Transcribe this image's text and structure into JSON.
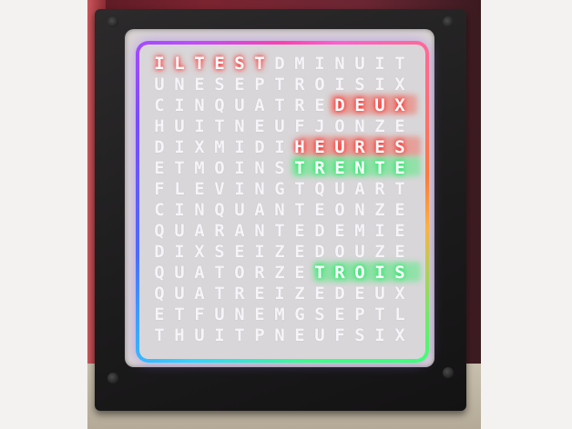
{
  "clock": {
    "rows": [
      "ILTESTDMINUIT",
      "UNESEPTROISIX",
      "CINQUATREDEUX",
      "HUITNEUFJONZE",
      "DIXMIDIHEURES",
      "ETMOINSTRENTE",
      "FLEVINGTQUART",
      "CINQUANTEONZE",
      "QUARANTEDEMIE",
      "DIXSEIZEDOUZE",
      "QUATORZETROIS",
      "QUATREIZEDEUX",
      "ETFUNEMGSEPTL",
      "THUITPNEUFSIX"
    ],
    "lit_words": [
      {
        "row": 0,
        "word": "ILTEST",
        "color": "#ff2b2b"
      },
      {
        "row": 2,
        "word": "DEUX",
        "color": "#ff2b2b"
      },
      {
        "row": 4,
        "word": "HEURES",
        "color": "#ff2b2b"
      },
      {
        "row": 5,
        "word": "TRENTE",
        "color": "#27e86a"
      },
      {
        "row": 10,
        "word": "TROIS",
        "color": "#27e86a"
      }
    ],
    "ring_colors": [
      "#ff3fb0",
      "#ff7a3a",
      "#3cff7a",
      "#2fd6ff",
      "#4a6bff",
      "#c04bff"
    ]
  }
}
